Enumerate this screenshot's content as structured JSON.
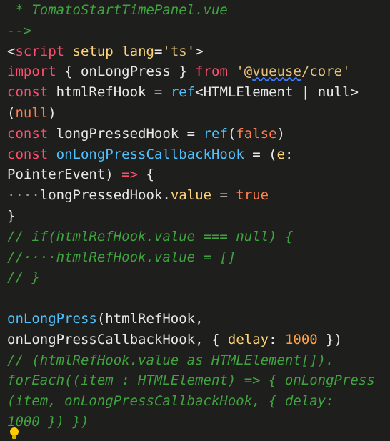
{
  "editor": {
    "lines": [
      [
        {
          "t": " * TomatoStartTimePanel.vue",
          "c": "c-comment"
        }
      ],
      [
        {
          "t": "-->",
          "c": "c-comment"
        }
      ],
      [
        {
          "t": "<",
          "c": "c-punc"
        },
        {
          "t": "script",
          "c": "c-tag"
        },
        {
          "t": " ",
          "c": "c-ident"
        },
        {
          "t": "setup",
          "c": "c-attr"
        },
        {
          "t": " ",
          "c": "c-ident"
        },
        {
          "t": "lang",
          "c": "c-attr"
        },
        {
          "t": "=",
          "c": "c-punc"
        },
        {
          "t": "'ts'",
          "c": "c-string"
        },
        {
          "t": ">",
          "c": "c-punc"
        }
      ],
      [
        {
          "t": "import",
          "c": "c-keyword"
        },
        {
          "t": " { ",
          "c": "c-punc"
        },
        {
          "t": "onLongPress",
          "c": "c-ident"
        },
        {
          "t": " } ",
          "c": "c-punc"
        },
        {
          "t": "from",
          "c": "c-keyword"
        },
        {
          "t": " ",
          "c": "c-ident"
        },
        {
          "t": "'@",
          "c": "c-string"
        },
        {
          "t": "vueuse",
          "c": "c-string c-under"
        },
        {
          "t": "/core'",
          "c": "c-string"
        }
      ],
      [
        {
          "t": "const",
          "c": "c-keyword"
        },
        {
          "t": " htmlRefHook ",
          "c": "c-ident"
        },
        {
          "t": "=",
          "c": "c-punc"
        },
        {
          "t": " ",
          "c": "c-ident"
        },
        {
          "t": "ref",
          "c": "c-func"
        },
        {
          "t": "<",
          "c": "c-punc"
        },
        {
          "t": "HTMLElement",
          "c": "c-type"
        },
        {
          "t": " | ",
          "c": "c-punc"
        },
        {
          "t": "null",
          "c": "c-type"
        },
        {
          "t": ">",
          "c": "c-punc"
        }
      ],
      [
        {
          "t": "(",
          "c": "c-punc"
        },
        {
          "t": "null",
          "c": "c-bool"
        },
        {
          "t": ")",
          "c": "c-punc"
        }
      ],
      [
        {
          "t": "const",
          "c": "c-keyword"
        },
        {
          "t": " longPressedHook ",
          "c": "c-ident"
        },
        {
          "t": "=",
          "c": "c-punc"
        },
        {
          "t": " ",
          "c": "c-ident"
        },
        {
          "t": "ref",
          "c": "c-func"
        },
        {
          "t": "(",
          "c": "c-punc"
        },
        {
          "t": "false",
          "c": "c-bool"
        },
        {
          "t": ")",
          "c": "c-punc"
        }
      ],
      [
        {
          "t": "const",
          "c": "c-keyword"
        },
        {
          "t": " ",
          "c": "c-ident"
        },
        {
          "t": "onLongPressCallbackHook",
          "c": "c-func"
        },
        {
          "t": " = (",
          "c": "c-punc"
        },
        {
          "t": "e",
          "c": "c-prop"
        },
        {
          "t": ":",
          "c": "c-punc"
        }
      ],
      [
        {
          "t": "PointerEvent",
          "c": "c-type"
        },
        {
          "t": ") ",
          "c": "c-punc"
        },
        {
          "t": "=>",
          "c": "c-keyword"
        },
        {
          "t": " {",
          "c": "c-punc"
        }
      ],
      [
        {
          "t": "····",
          "c": "c-faint"
        },
        {
          "t": "longPressedHook",
          "c": "c-ident"
        },
        {
          "t": ".",
          "c": "c-punc"
        },
        {
          "t": "value",
          "c": "c-prop"
        },
        {
          "t": " = ",
          "c": "c-punc"
        },
        {
          "t": "true",
          "c": "c-bool"
        }
      ],
      [
        {
          "t": "}",
          "c": "c-punc"
        }
      ],
      [
        {
          "t": "// if(htmlRefHook.value === null) {",
          "c": "c-comment"
        }
      ],
      [
        {
          "t": "//····htmlRefHook.value = []",
          "c": "c-comment"
        }
      ],
      [
        {
          "t": "// }",
          "c": "c-comment"
        }
      ],
      [
        {
          "t": "",
          "c": "c-ident"
        }
      ],
      [
        {
          "t": "onLongPress",
          "c": "c-func"
        },
        {
          "t": "(",
          "c": "c-punc"
        },
        {
          "t": "htmlRefHook",
          "c": "c-ident"
        },
        {
          "t": ",",
          "c": "c-punc"
        }
      ],
      [
        {
          "t": "onLongPressCallbackHook",
          "c": "c-ident"
        },
        {
          "t": ", { ",
          "c": "c-punc"
        },
        {
          "t": "delay",
          "c": "c-prop"
        },
        {
          "t": ": ",
          "c": "c-punc"
        },
        {
          "t": "1000",
          "c": "c-num"
        },
        {
          "t": " })",
          "c": "c-punc"
        }
      ],
      [
        {
          "t": "// (htmlRefHook.value as HTMLElement[]).",
          "c": "c-comment"
        }
      ],
      [
        {
          "t": "forEach((item : HTMLElement) => { onLongPress",
          "c": "c-comment"
        }
      ],
      [
        {
          "t": "(item, onLongPressCallbackHook, { delay:",
          "c": "c-comment"
        }
      ],
      [
        {
          "t": "1000 }) })",
          "c": "c-comment"
        }
      ]
    ]
  }
}
